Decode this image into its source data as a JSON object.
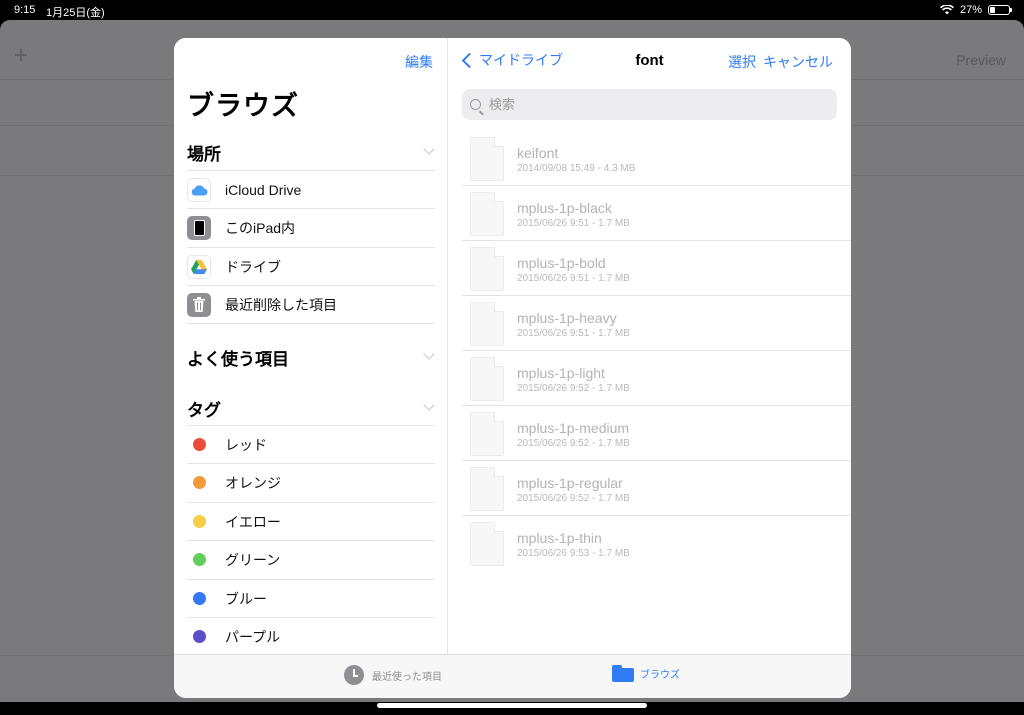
{
  "status_bar": {
    "time": "9:15",
    "date": "1月25日(金)",
    "battery": "27%",
    "battery_level": 0.27
  },
  "background_app": {
    "add_label": "+",
    "preview_label": "Preview"
  },
  "sidebar": {
    "edit_label": "編集",
    "title": "ブラウズ",
    "locations": {
      "heading": "場所",
      "items": [
        {
          "label": "iCloud Drive",
          "icon": "icloud-icon"
        },
        {
          "label": "このiPad内",
          "icon": "ipad-icon"
        },
        {
          "label": "ドライブ",
          "icon": "google-drive-icon"
        },
        {
          "label": "最近削除した項目",
          "icon": "trash-icon"
        }
      ]
    },
    "favorites": {
      "heading": "よく使う項目"
    },
    "tags": {
      "heading": "タグ",
      "items": [
        {
          "label": "レッド",
          "color": "#eb4d3d"
        },
        {
          "label": "オレンジ",
          "color": "#f19a38"
        },
        {
          "label": "イエロー",
          "color": "#f7ce46"
        },
        {
          "label": "グリーン",
          "color": "#65cd5c"
        },
        {
          "label": "ブルー",
          "color": "#3478f6"
        },
        {
          "label": "パープル",
          "color": "#5b4ecb"
        }
      ]
    }
  },
  "pane": {
    "back_label": "マイドライブ",
    "title": "font",
    "select_label": "選択",
    "cancel_label": "キャンセル",
    "search_placeholder": "検索",
    "files": [
      {
        "name": "keifont",
        "meta": "2014/09/08 15:49 - 4.3 MB"
      },
      {
        "name": "mplus-1p-black",
        "meta": "2015/06/26 9:51 - 1.7 MB"
      },
      {
        "name": "mplus-1p-bold",
        "meta": "2015/06/26 9:51 - 1.7 MB"
      },
      {
        "name": "mplus-1p-heavy",
        "meta": "2015/06/26 9:51 - 1.7 MB"
      },
      {
        "name": "mplus-1p-light",
        "meta": "2015/06/26 9:52 - 1.7 MB"
      },
      {
        "name": "mplus-1p-medium",
        "meta": "2015/06/26 9:52 - 1.7 MB"
      },
      {
        "name": "mplus-1p-regular",
        "meta": "2015/06/26 9:52 - 1.7 MB"
      },
      {
        "name": "mplus-1p-thin",
        "meta": "2015/06/26 9:53 - 1.7 MB"
      }
    ]
  },
  "tabbar": {
    "recent_label": "最近使った項目",
    "browse_label": "ブラウズ"
  },
  "colors": {
    "accent": "#2f7cf6",
    "gray_icon": "#8e8e93"
  }
}
